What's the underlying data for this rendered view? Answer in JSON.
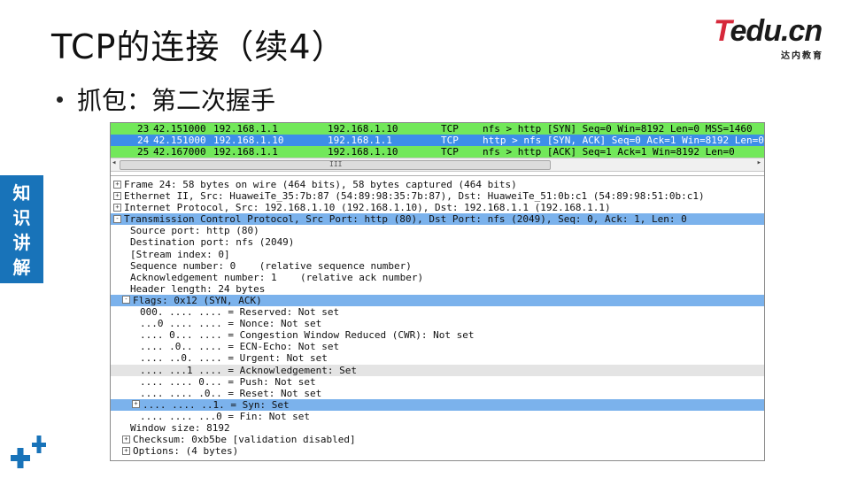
{
  "slide": {
    "title": "TCP的连接（续4）",
    "bullet": "抓包：第二次握手",
    "side_tab": [
      "知",
      "识",
      "讲",
      "解"
    ],
    "logo": {
      "brand_t": "T",
      "brand_rest": "edu.cn",
      "sub": "达内教育"
    }
  },
  "packet_list": [
    {
      "no": "23",
      "time": "42.151000",
      "src": "192.168.1.1",
      "dst": "192.168.1.10",
      "proto": "TCP",
      "info": "nfs > http [SYN] Seq=0 Win=8192 Len=0 MSS=1460",
      "style": "green"
    },
    {
      "no": "24",
      "time": "42.151000",
      "src": "192.168.1.10",
      "dst": "192.168.1.1",
      "proto": "TCP",
      "info": "http > nfs [SYN, ACK] Seq=0 Ack=1 Win=8192 Len=0",
      "style": "selected"
    },
    {
      "no": "25",
      "time": "42.167000",
      "src": "192.168.1.1",
      "dst": "192.168.1.10",
      "proto": "TCP",
      "info": "nfs > http [ACK] Seq=1 Ack=1 Win=8192 Len=0",
      "style": "green"
    }
  ],
  "scrollbar": {
    "grip": "III"
  },
  "details": [
    {
      "indent": 0,
      "exp": "+",
      "text": "Frame 24: 58 bytes on wire (464 bits), 58 bytes captured (464 bits)",
      "style": ""
    },
    {
      "indent": 0,
      "exp": "+",
      "text": "Ethernet II, Src: HuaweiTe_35:7b:87 (54:89:98:35:7b:87), Dst: HuaweiTe_51:0b:c1 (54:89:98:51:0b:c1)",
      "style": ""
    },
    {
      "indent": 0,
      "exp": "+",
      "text": "Internet Protocol, Src: 192.168.1.10 (192.168.1.10), Dst: 192.168.1.1 (192.168.1.1)",
      "style": ""
    },
    {
      "indent": 0,
      "exp": "-",
      "text": "Transmission Control Protocol, Src Port: http (80), Dst Port: nfs (2049), Seq: 0, Ack: 1, Len: 0",
      "style": "hl"
    },
    {
      "indent": 1,
      "exp": "",
      "text": "Source port: http (80)",
      "style": ""
    },
    {
      "indent": 1,
      "exp": "",
      "text": "Destination port: nfs (2049)",
      "style": ""
    },
    {
      "indent": 1,
      "exp": "",
      "text": "[Stream index: 0]",
      "style": ""
    },
    {
      "indent": 1,
      "exp": "",
      "text": "Sequence number: 0    (relative sequence number)",
      "style": ""
    },
    {
      "indent": 1,
      "exp": "",
      "text": "Acknowledgement number: 1    (relative ack number)",
      "style": ""
    },
    {
      "indent": 1,
      "exp": "",
      "text": "Header length: 24 bytes",
      "style": ""
    },
    {
      "indent": 1,
      "exp": "-",
      "text": "Flags: 0x12 (SYN, ACK)",
      "style": "hl"
    },
    {
      "indent": 2,
      "exp": "",
      "text": "000. .... .... = Reserved: Not set",
      "style": ""
    },
    {
      "indent": 2,
      "exp": "",
      "text": "...0 .... .... = Nonce: Not set",
      "style": ""
    },
    {
      "indent": 2,
      "exp": "",
      "text": ".... 0... .... = Congestion Window Reduced (CWR): Not set",
      "style": ""
    },
    {
      "indent": 2,
      "exp": "",
      "text": ".... .0.. .... = ECN-Echo: Not set",
      "style": ""
    },
    {
      "indent": 2,
      "exp": "",
      "text": ".... ..0. .... = Urgent: Not set",
      "style": ""
    },
    {
      "indent": 2,
      "exp": "",
      "text": ".... ...1 .... = Acknowledgement: Set",
      "style": "gray"
    },
    {
      "indent": 2,
      "exp": "",
      "text": ".... .... 0... = Push: Not set",
      "style": ""
    },
    {
      "indent": 2,
      "exp": "",
      "text": ".... .... .0.. = Reset: Not set",
      "style": ""
    },
    {
      "indent": 2,
      "exp": "+",
      "text": ".... .... ..1. = Syn: Set",
      "style": "hl"
    },
    {
      "indent": 2,
      "exp": "",
      "text": ".... .... ...0 = Fin: Not set",
      "style": ""
    },
    {
      "indent": 1,
      "exp": "",
      "text": "Window size: 8192",
      "style": ""
    },
    {
      "indent": 1,
      "exp": "+",
      "text": "Checksum: 0xb5be [validation disabled]",
      "style": ""
    },
    {
      "indent": 1,
      "exp": "+",
      "text": "Options: (4 bytes)",
      "style": ""
    }
  ]
}
